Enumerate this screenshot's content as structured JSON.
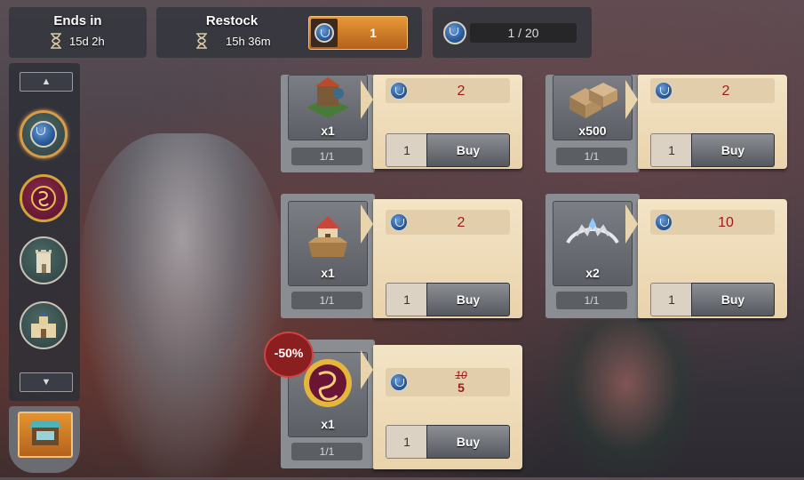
{
  "header": {
    "ends_in": {
      "label": "Ends in",
      "value": "15d 2h"
    },
    "restock": {
      "label": "Restock",
      "value": "15h 36m",
      "cost": "1"
    },
    "counter": "1 / 20"
  },
  "sidebar": {
    "scroll_up_icon": "triangle-up-icon",
    "scroll_down_icon": "triangle-down-icon",
    "items": [
      {
        "icon": "blue-castle-coin-icon",
        "active": true
      },
      {
        "icon": "gold-dragon-coin-icon",
        "active": false
      },
      {
        "icon": "tower-icon",
        "active": false
      },
      {
        "icon": "castle-icon",
        "active": false
      }
    ],
    "shop_icon": "shop-stall-icon"
  },
  "offers": [
    {
      "item": "building-icon",
      "qty": "x1",
      "stock": "1/1",
      "price": "2",
      "buy_qty": "1",
      "buy_label": "Buy"
    },
    {
      "item": "wood-crates-icon",
      "qty": "x500",
      "stock": "1/1",
      "price": "2",
      "buy_qty": "1",
      "buy_label": "Buy"
    },
    {
      "item": "house-box-icon",
      "qty": "x1",
      "stock": "1/1",
      "price": "2",
      "buy_qty": "1",
      "buy_label": "Buy"
    },
    {
      "item": "tiara-icon",
      "qty": "x2",
      "stock": "1/1",
      "price": "10",
      "buy_qty": "1",
      "buy_label": "Buy"
    },
    {
      "item": "dragon-coin-icon",
      "qty": "x1",
      "stock": "1/1",
      "old_price": "10",
      "price": "5",
      "discount": "-50%",
      "buy_qty": "1",
      "buy_label": "Buy"
    }
  ],
  "colors": {
    "accent": "#d99a4a",
    "price": "#9a1d1d",
    "panel": "#f3e4c6"
  }
}
